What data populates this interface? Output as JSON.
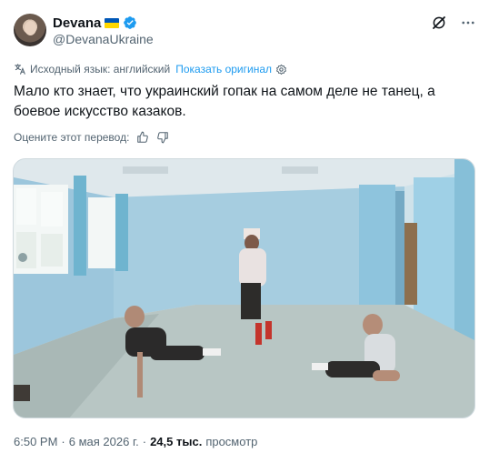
{
  "author": {
    "display_name": "Devana",
    "handle": "@DevanaUkraine",
    "verified": true,
    "flag": "ukraine-flag-icon"
  },
  "translation": {
    "source_text": "Исходный язык: английский",
    "show_original": "Показать оригинал"
  },
  "tweet": {
    "text": "Мало кто знает, что украинский гопак на самом деле не танец, а боевое искусство казаков."
  },
  "rating": {
    "label": "Оцените этот перевод:"
  },
  "meta": {
    "time": "6:50 PM",
    "separator1": "·",
    "date": "6 мая 2026 г.",
    "separator2": "·",
    "views_count": "24,5 тыс.",
    "views_label": "просмотр"
  },
  "colors": {
    "accent": "#1d9bf0",
    "secondary_text": "#536471",
    "primary_text": "#0f1419",
    "flag_blue": "#0057b7",
    "flag_yellow": "#ffd700"
  }
}
